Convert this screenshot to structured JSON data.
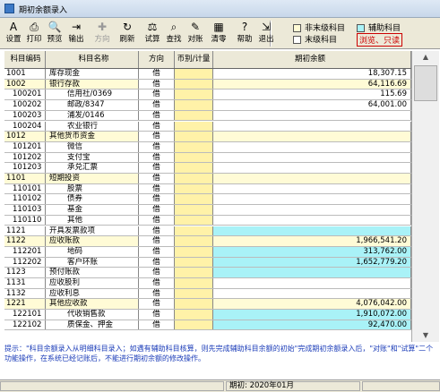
{
  "window": {
    "title": "期初余额录入"
  },
  "toolbar": {
    "buttons": [
      {
        "id": "settings",
        "label": "设置",
        "icon": "settings-icon",
        "glyph": "A",
        "disabled": false
      },
      {
        "id": "print",
        "label": "打印",
        "icon": "printer-icon",
        "glyph": "⎙",
        "disabled": false
      },
      {
        "id": "preview",
        "label": "预览",
        "icon": "preview-icon",
        "glyph": "🔍",
        "disabled": false
      },
      {
        "id": "export",
        "label": "输出",
        "icon": "export-icon",
        "glyph": "⇥",
        "disabled": false
      },
      {
        "id": "direction",
        "label": "方向",
        "icon": "direction-icon",
        "glyph": "✚",
        "disabled": true
      },
      {
        "id": "refresh",
        "label": "刷新",
        "icon": "refresh-icon",
        "glyph": "↻",
        "disabled": false
      },
      {
        "id": "trial",
        "label": "试算",
        "icon": "balance-scale-icon",
        "glyph": "⚖",
        "disabled": false
      },
      {
        "id": "find",
        "label": "查找",
        "icon": "find-icon",
        "glyph": "⌕",
        "disabled": false
      },
      {
        "id": "reconcile",
        "label": "对账",
        "icon": "reconcile-icon",
        "glyph": "✎",
        "disabled": false
      },
      {
        "id": "clear",
        "label": "清零",
        "icon": "clear-icon",
        "glyph": "▦",
        "disabled": false
      },
      {
        "id": "help",
        "label": "帮助",
        "icon": "help-icon",
        "glyph": "?",
        "disabled": false
      },
      {
        "id": "exit",
        "label": "退出",
        "icon": "exit-icon",
        "glyph": "⇲",
        "disabled": false
      }
    ],
    "legend": {
      "non_leaf": "非末级科目",
      "leaf": "末级科目",
      "aux": "辅助科目",
      "readonly": "浏览、只读"
    }
  },
  "table": {
    "headers": [
      "科目编码",
      "科目名称",
      "方向",
      "币别/计量",
      "期初余额"
    ],
    "rows": [
      {
        "code": "1001",
        "name": "库存现金",
        "dir": "借",
        "cur": "",
        "amount": "18,307.15",
        "indent": 0,
        "type": "leaf"
      },
      {
        "code": "1002",
        "name": "银行存款",
        "dir": "借",
        "cur": "",
        "amount": "64,116.69",
        "indent": 0,
        "type": "parent"
      },
      {
        "code": "100201",
        "name": "信用社/0369",
        "dir": "借",
        "cur": "",
        "amount": "115.69",
        "indent": 1,
        "type": "leaf"
      },
      {
        "code": "100202",
        "name": "邮政/8347",
        "dir": "借",
        "cur": "",
        "amount": "64,001.00",
        "indent": 1,
        "type": "leaf"
      },
      {
        "code": "100203",
        "name": "浦发/0146",
        "dir": "借",
        "cur": "",
        "amount": "",
        "indent": 1,
        "type": "leaf"
      },
      {
        "code": "100204",
        "name": "农业银行",
        "dir": "借",
        "cur": "",
        "amount": "",
        "indent": 1,
        "type": "leaf"
      },
      {
        "code": "1012",
        "name": "其他货币资金",
        "dir": "借",
        "cur": "",
        "amount": "",
        "indent": 0,
        "type": "parent"
      },
      {
        "code": "101201",
        "name": "微信",
        "dir": "借",
        "cur": "",
        "amount": "",
        "indent": 1,
        "type": "leaf"
      },
      {
        "code": "101202",
        "name": "支付宝",
        "dir": "借",
        "cur": "",
        "amount": "",
        "indent": 1,
        "type": "leaf"
      },
      {
        "code": "101203",
        "name": "承兑汇票",
        "dir": "借",
        "cur": "",
        "amount": "",
        "indent": 1,
        "type": "leaf"
      },
      {
        "code": "1101",
        "name": "短期投资",
        "dir": "借",
        "cur": "",
        "amount": "",
        "indent": 0,
        "type": "parent"
      },
      {
        "code": "110101",
        "name": "股票",
        "dir": "借",
        "cur": "",
        "amount": "",
        "indent": 1,
        "type": "leaf"
      },
      {
        "code": "110102",
        "name": "债券",
        "dir": "借",
        "cur": "",
        "amount": "",
        "indent": 1,
        "type": "leaf"
      },
      {
        "code": "110103",
        "name": "基金",
        "dir": "借",
        "cur": "",
        "amount": "",
        "indent": 1,
        "type": "leaf"
      },
      {
        "code": "110110",
        "name": "其他",
        "dir": "借",
        "cur": "",
        "amount": "",
        "indent": 1,
        "type": "leaf"
      },
      {
        "code": "1121",
        "name": "开具发票款项",
        "dir": "借",
        "cur": "",
        "amount": "",
        "indent": 0,
        "type": "aux"
      },
      {
        "code": "1122",
        "name": "应收账款",
        "dir": "借",
        "cur": "",
        "amount": "1,966,541.20",
        "indent": 0,
        "type": "parent"
      },
      {
        "code": "112201",
        "name": "地码",
        "dir": "借",
        "cur": "",
        "amount": "313,762.00",
        "indent": 1,
        "type": "aux"
      },
      {
        "code": "112202",
        "name": "客户环账",
        "dir": "借",
        "cur": "",
        "amount": "1,652,779.20",
        "indent": 1,
        "type": "aux"
      },
      {
        "code": "1123",
        "name": "预付账款",
        "dir": "借",
        "cur": "",
        "amount": "",
        "indent": 0,
        "type": "aux"
      },
      {
        "code": "1131",
        "name": "应收股利",
        "dir": "借",
        "cur": "",
        "amount": "",
        "indent": 0,
        "type": "leaf"
      },
      {
        "code": "1132",
        "name": "应收利息",
        "dir": "借",
        "cur": "",
        "amount": "",
        "indent": 0,
        "type": "leaf"
      },
      {
        "code": "1221",
        "name": "其他应收款",
        "dir": "借",
        "cur": "",
        "amount": "4,076,042.00",
        "indent": 0,
        "type": "parent"
      },
      {
        "code": "122101",
        "name": "代收销售款",
        "dir": "借",
        "cur": "",
        "amount": "1,910,072.00",
        "indent": 1,
        "type": "aux"
      },
      {
        "code": "122102",
        "name": "质保金、押金",
        "dir": "借",
        "cur": "",
        "amount": "92,470.00",
        "indent": 1,
        "type": "aux"
      }
    ]
  },
  "hint": "提示：\"科目余额录入从明细科目录入；如遇有辅助科目核算，则先完成辅助科目余额的初始\"完成期初余额录入后，\"对账\"和\"试算\"二个功能操作，在系统已经记账后，不能进行期初余额的修改操作。",
  "status": {
    "period_label": "期初: 2020年01月"
  },
  "colors": {
    "parent": "#fffbd6",
    "aux": "#a9f2f7",
    "leaf": "#ffffff",
    "cur_col": "#fff2a8",
    "readonly": "#cc0000"
  }
}
